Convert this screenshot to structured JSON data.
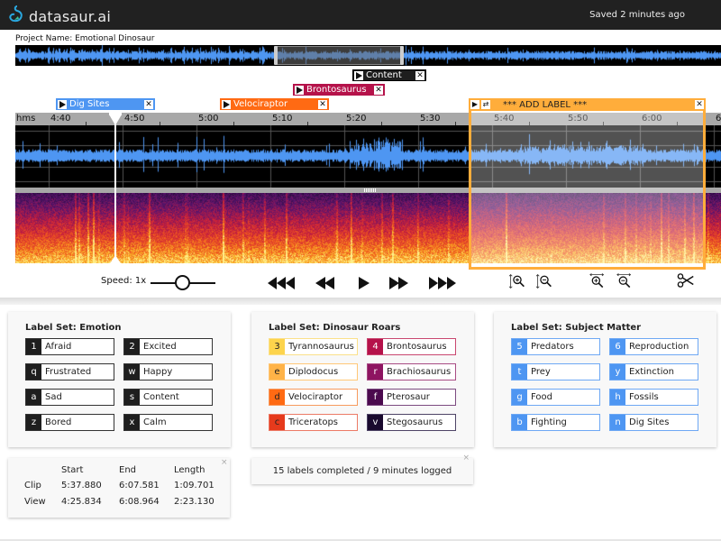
{
  "header": {
    "app_name": "datasaur.ai",
    "logo_icon": "dinosaur-logo-icon",
    "save_status": "Saved 2 minutes ago"
  },
  "project": {
    "label": "Project Name: Emotional Dinosaur"
  },
  "timeline": {
    "unit_label": "hms",
    "ticks": [
      "4:40",
      "4:50",
      "5:00",
      "5:10",
      "5:20",
      "5:30",
      "5:40",
      "5:50",
      "6:00",
      "6:"
    ],
    "playhead_time": "4:48",
    "overview_view_window_fraction": [
      0.37,
      0.55
    ]
  },
  "segment_labels": [
    {
      "name": "Content",
      "color": "#1e1e1e",
      "border": "#000000"
    },
    {
      "name": "Brontosaurus",
      "color": "#b5124a",
      "border": "#b5124a"
    },
    {
      "name": "Dig Sites",
      "color": "#4e96f2",
      "border": "#4e96f2"
    },
    {
      "name": "Velociraptor",
      "color": "#ff6a13",
      "border": "#ff6a13"
    }
  ],
  "selection": {
    "title": "*** ADD LABEL ***",
    "color": "#ffad3b",
    "play_icon": "play-icon",
    "loop_icon": "loop-icon",
    "close_icon": "close-icon"
  },
  "controls": {
    "speed_label": "Speed: 1x",
    "speed_value": 1,
    "buttons": [
      "fast-rewind-button",
      "rewind-button",
      "play-button",
      "forward-button",
      "fast-forward-button",
      "vertical-zoom-in-button",
      "vertical-zoom-out-button",
      "horizontal-zoom-in-button",
      "horizontal-zoom-out-button",
      "cut-button"
    ]
  },
  "label_sets": [
    {
      "title": "Label Set: Emotion",
      "labels": [
        {
          "key": "1",
          "name": "Afraid",
          "color": "#1e1e1e",
          "border": "#333333"
        },
        {
          "key": "2",
          "name": "Excited",
          "color": "#1e1e1e",
          "border": "#333333"
        },
        {
          "key": "q",
          "name": "Frustrated",
          "color": "#1e1e1e",
          "border": "#333333"
        },
        {
          "key": "w",
          "name": "Happy",
          "color": "#1e1e1e",
          "border": "#333333"
        },
        {
          "key": "a",
          "name": "Sad",
          "color": "#1e1e1e",
          "border": "#333333"
        },
        {
          "key": "s",
          "name": "Content",
          "color": "#1e1e1e",
          "border": "#333333"
        },
        {
          "key": "z",
          "name": "Bored",
          "color": "#1e1e1e",
          "border": "#333333"
        },
        {
          "key": "x",
          "name": "Calm",
          "color": "#1e1e1e",
          "border": "#333333"
        }
      ]
    },
    {
      "title": "Label Set: Dinosaur Roars",
      "labels": [
        {
          "key": "3",
          "name": "Tyrannosaurus",
          "color": "#fdd44c",
          "border": "#fbe08a",
          "key_text": "#222222"
        },
        {
          "key": "4",
          "name": "Brontosaurus",
          "color": "#b5124a",
          "border": "#c9476f"
        },
        {
          "key": "e",
          "name": "Diplodocus",
          "color": "#ffb347",
          "border": "#ffc777",
          "key_text": "#222222"
        },
        {
          "key": "r",
          "name": "Brachiosaurus",
          "color": "#8e1461",
          "border": "#a84c84"
        },
        {
          "key": "d",
          "name": "Velociraptor",
          "color": "#ff6a13",
          "border": "#f79a5e",
          "key_text": "#222222"
        },
        {
          "key": "f",
          "name": "Pterosaur",
          "color": "#4b0a4e",
          "border": "#7c4a80"
        },
        {
          "key": "c",
          "name": "Triceratops",
          "color": "#e63a1c",
          "border": "#ec7a66",
          "key_text": "#222222"
        },
        {
          "key": "v",
          "name": "Stegosaurus",
          "color": "#1a0a2e",
          "border": "#4e4466"
        }
      ]
    },
    {
      "title": "Label Set: Subject Matter",
      "labels": [
        {
          "key": "5",
          "name": "Predators",
          "color": "#4e96f2",
          "border": "#6ea8f4"
        },
        {
          "key": "6",
          "name": "Reproduction",
          "color": "#4e96f2",
          "border": "#6ea8f4"
        },
        {
          "key": "t",
          "name": "Prey",
          "color": "#4e96f2",
          "border": "#6ea8f4"
        },
        {
          "key": "y",
          "name": "Extinction",
          "color": "#4e96f2",
          "border": "#6ea8f4"
        },
        {
          "key": "g",
          "name": "Food",
          "color": "#4e96f2",
          "border": "#6ea8f4"
        },
        {
          "key": "h",
          "name": "Fossils",
          "color": "#4e96f2",
          "border": "#6ea8f4"
        },
        {
          "key": "b",
          "name": "Fighting",
          "color": "#4e96f2",
          "border": "#6ea8f4"
        },
        {
          "key": "n",
          "name": "Dig Sites",
          "color": "#4e96f2",
          "border": "#6ea8f4"
        }
      ]
    }
  ],
  "stats": {
    "columns": [
      "Start",
      "End",
      "Length"
    ],
    "rows": [
      {
        "name": "Clip",
        "start": "5:37.880",
        "end": "6:07.581",
        "length": "1:09.701"
      },
      {
        "name": "View",
        "start": "4:25.834",
        "end": "6:08.964",
        "length": "2:23.130"
      }
    ],
    "close_label": "×"
  },
  "summary": {
    "text": "15 labels completed / 9 minutes logged",
    "close_label": "×"
  },
  "colors": {
    "waveform": "#4e96f2",
    "topbar": "#212121",
    "selection": "#ffad3b"
  }
}
